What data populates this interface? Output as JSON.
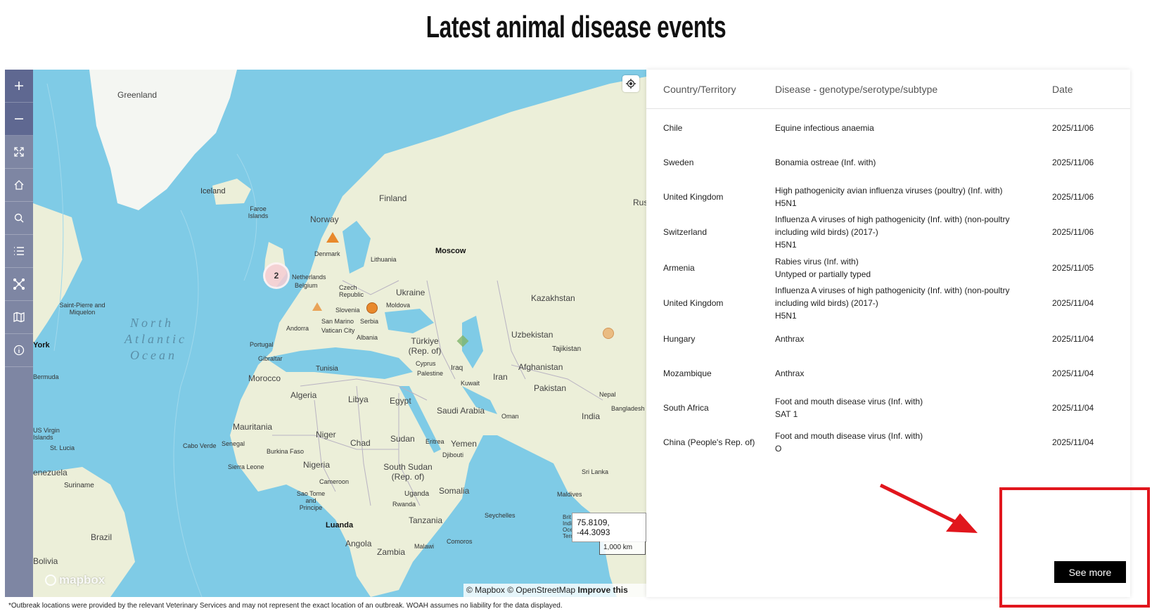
{
  "page": {
    "title": "Latest animal disease events",
    "footnote": "*Outbreak locations were provided by the relevant Veterinary Services and may not represent the exact location of an outbreak. WOAH assumes no liability for the data displayed."
  },
  "map": {
    "toolbar": [
      "zoom-in",
      "zoom-out",
      "fullscreen",
      "home",
      "search",
      "list",
      "network",
      "layers",
      "info"
    ],
    "labels": {
      "greenland": "Greenland",
      "iceland": "Iceland",
      "faroe": "Faroe Islands",
      "norway": "Norway",
      "finland": "Finland",
      "denmark": "Denmark",
      "lithuania": "Lithuania",
      "netherlands": "Netherlands",
      "belgium": "Belgium",
      "czech": "Czech Republic",
      "ukraine": "Ukraine",
      "moldova": "Moldova",
      "slovenia": "Slovenia",
      "sanmarino": "San Marino",
      "serbia": "Serbia",
      "vatican": "Vatican City",
      "albania": "Albania",
      "andorra": "Andorra",
      "portugal": "Portugal",
      "gibraltar": "Gibraltar",
      "turkiye": "Türkiye (Rep. of)",
      "cyprus": "Cyprus",
      "palestine": "Palestine",
      "kuwait": "Kuwait",
      "iraq": "Iraq",
      "iran": "Iran",
      "afghanistan": "Afghanistan",
      "pakistan": "Pakistan",
      "kazakhstan": "Kazakhstan",
      "uzbekistan": "Uzbekistan",
      "tajikistan": "Tajikistan",
      "nepal": "Nepal",
      "bangladesh": "Bangladesh",
      "india": "India",
      "srilanka": "Sri Lanka",
      "maldives": "Maldives",
      "russia": "Rus",
      "tunisia": "Tunisia",
      "morocco": "Morocco",
      "algeria": "Algeria",
      "libya": "Libya",
      "egypt": "Egypt",
      "saudi": "Saudi Arabia",
      "oman": "Oman",
      "yemen": "Yemen",
      "eritrea": "Eritrea",
      "djibouti": "Djibouti",
      "sudan": "Sudan",
      "southsudan": "South Sudan (Rep. of)",
      "somalia": "Somalia",
      "chad": "Chad",
      "niger": "Niger",
      "nigeria": "Nigeria",
      "mauritania": "Mauritania",
      "senegal": "Senegal",
      "burkina": "Burkina Faso",
      "sierraleone": "Sierra Leone",
      "cameroon": "Cameroon",
      "saotome": "Sao Tome and Principe",
      "uganda": "Uganda",
      "rwanda": "Rwanda",
      "tanzania": "Tanzania",
      "seychelles": "Seychelles",
      "comoros": "Comoros",
      "malawi": "Malawi",
      "angola": "Angola",
      "zambia": "Zambia",
      "luanda": "Luanda",
      "caboverde": "Cabo Verde",
      "brazil": "Brazil",
      "bolivia": "Bolivia",
      "suriname": "Suriname",
      "venezuela": "enezuela",
      "usvi": "US Virgin Islands",
      "stlucia": "St. Lucia",
      "bermuda": "Bermuda",
      "spm": "Saint-Pierre and Miquelon",
      "york": "York",
      "moscow": "Moscow",
      "ocean1": "North",
      "ocean2": "Atlantic",
      "ocean3": "Ocean",
      "brit": "Brit Indian Ocean Territory"
    },
    "cluster_count": "2",
    "coordinates": "75.8109, -44.3093",
    "scale": "1,000 km",
    "attribution_text": "© Mapbox © OpenStreetMap",
    "attribution_link": "Improve this map",
    "logo": "mapbox"
  },
  "table": {
    "headers": {
      "country": "Country/Territory",
      "disease": "Disease - genotype/serotype/subtype",
      "date": "Date"
    },
    "rows": [
      {
        "country": "Chile",
        "disease": [
          "Equine infectious anaemia"
        ],
        "date": "2025/11/06"
      },
      {
        "country": "Sweden",
        "disease": [
          "Bonamia ostreae (Inf. with)"
        ],
        "date": "2025/11/06"
      },
      {
        "country": "United Kingdom",
        "disease": [
          "High pathogenicity avian influenza viruses (poultry) (Inf. with)",
          "H5N1"
        ],
        "date": "2025/11/06"
      },
      {
        "country": "Switzerland",
        "disease": [
          "Influenza A viruses of high pathogenicity (Inf. with) (non-poultry",
          "including wild birds) (2017-)",
          "H5N1"
        ],
        "date": "2025/11/06"
      },
      {
        "country": "Armenia",
        "disease": [
          "Rabies virus (Inf. with)",
          "Untyped or partially typed"
        ],
        "date": "2025/11/05"
      },
      {
        "country": "United Kingdom",
        "disease": [
          "Influenza A viruses of high pathogenicity (Inf. with) (non-poultry",
          "including wild birds) (2017-)",
          "H5N1"
        ],
        "date": "2025/11/04"
      },
      {
        "country": "Hungary",
        "disease": [
          "Anthrax"
        ],
        "date": "2025/11/04"
      },
      {
        "country": "Mozambique",
        "disease": [
          "Anthrax"
        ],
        "date": "2025/11/04"
      },
      {
        "country": "South Africa",
        "disease": [
          "Foot and mouth disease virus (Inf. with)",
          "SAT 1"
        ],
        "date": "2025/11/04"
      },
      {
        "country": "China (People's Rep. of)",
        "disease": [
          "Foot and mouth disease virus (Inf. with)",
          "O"
        ],
        "date": "2025/11/04"
      }
    ],
    "see_more_label": "See more"
  },
  "colors": {
    "ocean": "#7fcbe6",
    "land": "#ecefd9",
    "toolbar": "#7e86a3",
    "marker": "#e8892c",
    "highlight": "#e1161d"
  }
}
